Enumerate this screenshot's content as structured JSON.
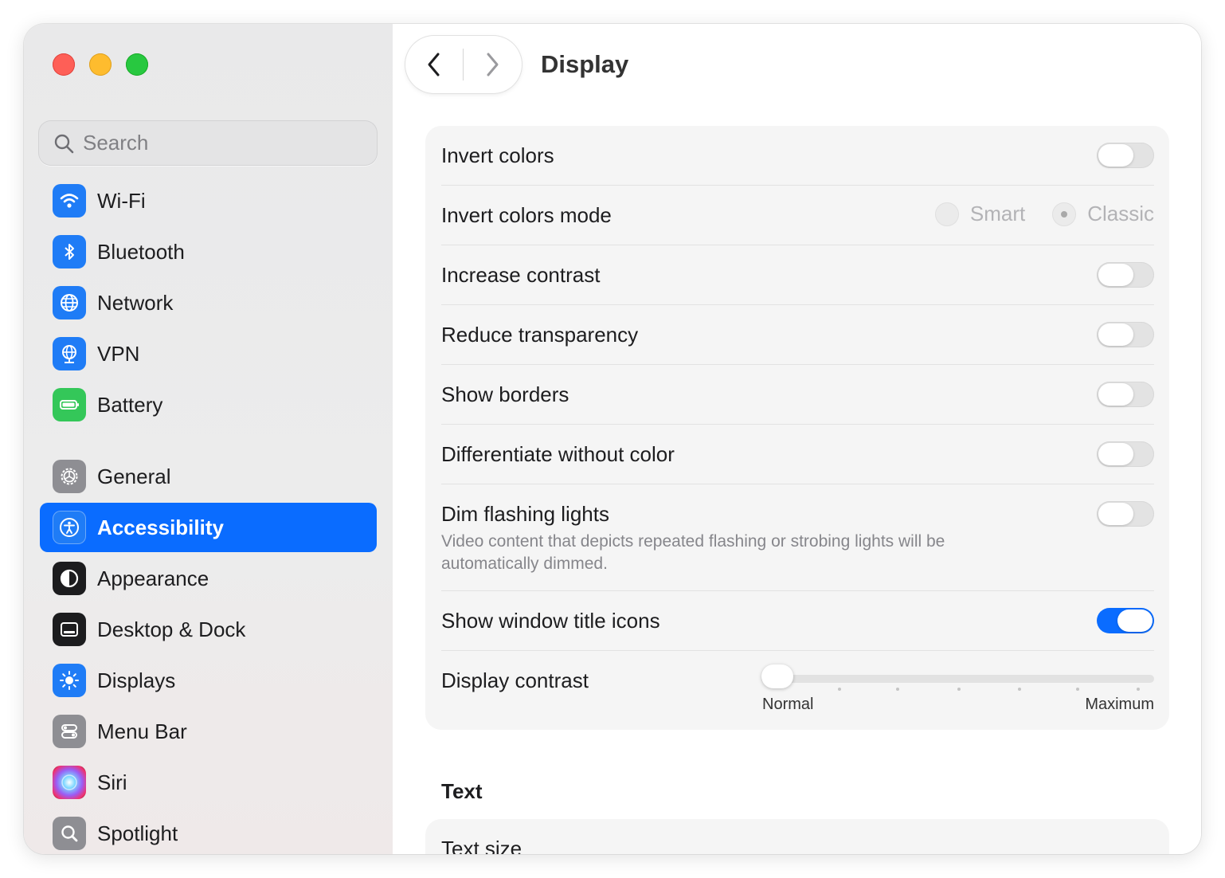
{
  "window": {
    "search_placeholder": "Search",
    "title": "Display"
  },
  "sidebar": {
    "items": [
      {
        "label": "Wi-Fi",
        "icon": "wifi-icon",
        "color": "#1f7cf6"
      },
      {
        "label": "Bluetooth",
        "icon": "bluetooth-icon",
        "color": "#1f7cf6"
      },
      {
        "label": "Network",
        "icon": "globe-icon",
        "color": "#1f7cf6"
      },
      {
        "label": "VPN",
        "icon": "vpn-globe-icon",
        "color": "#1f7cf6"
      },
      {
        "label": "Battery",
        "icon": "battery-icon",
        "color": "#34c759"
      },
      {
        "label": "General",
        "icon": "gear-icon",
        "color": "#8e8e93"
      },
      {
        "label": "Accessibility",
        "icon": "accessibility-icon",
        "color": "#1f7cf6",
        "selected": true
      },
      {
        "label": "Appearance",
        "icon": "appearance-icon",
        "color": "#1c1c1e"
      },
      {
        "label": "Desktop & Dock",
        "icon": "dock-icon",
        "color": "#1c1c1e"
      },
      {
        "label": "Displays",
        "icon": "sun-icon",
        "color": "#1f7cf6"
      },
      {
        "label": "Menu Bar",
        "icon": "menu-bar-icon",
        "color": "#8e8e93"
      },
      {
        "label": "Siri",
        "icon": "siri-icon",
        "color": "#3a3a8c"
      },
      {
        "label": "Spotlight",
        "icon": "magnifier-icon",
        "color": "#8e8e93"
      }
    ]
  },
  "settings": {
    "invert_colors": {
      "label": "Invert colors",
      "on": false
    },
    "invert_mode": {
      "label": "Invert colors mode",
      "options": [
        "Smart",
        "Classic"
      ],
      "selected": "Classic"
    },
    "increase_contrast": {
      "label": "Increase contrast",
      "on": false
    },
    "reduce_transparency": {
      "label": "Reduce transparency",
      "on": false
    },
    "show_borders": {
      "label": "Show borders",
      "on": false
    },
    "differentiate": {
      "label": "Differentiate without color",
      "on": false
    },
    "dim_flashing": {
      "label": "Dim flashing lights",
      "description": "Video content that depicts repeated flashing or strobing lights will be automatically dimmed.",
      "on": false
    },
    "title_icons": {
      "label": "Show window title icons",
      "on": true
    },
    "display_contrast": {
      "label": "Display contrast",
      "min_label": "Normal",
      "max_label": "Maximum",
      "value": 0
    }
  },
  "text_section": {
    "title": "Text",
    "text_size_label": "Text size"
  },
  "colors": {
    "accent": "#0a6cff"
  }
}
